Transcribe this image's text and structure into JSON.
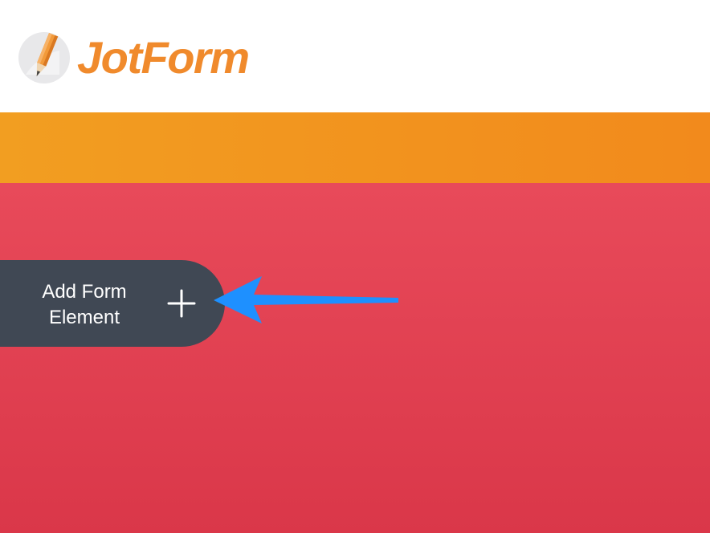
{
  "header": {
    "logo_text": "JotForm"
  },
  "add_element_button": {
    "line1": "Add Form",
    "line2": "Element"
  },
  "icons": {
    "logo": "jotform-pencil-logo-icon",
    "plus": "plus-icon",
    "annotation": "arrow-annotation-icon"
  },
  "colors": {
    "brand_orange": "#f08a2c",
    "band_orange": "#f2961f",
    "page_red": "#e2424f",
    "button_dark": "#404854",
    "annotation_blue": "#1e90ff"
  }
}
